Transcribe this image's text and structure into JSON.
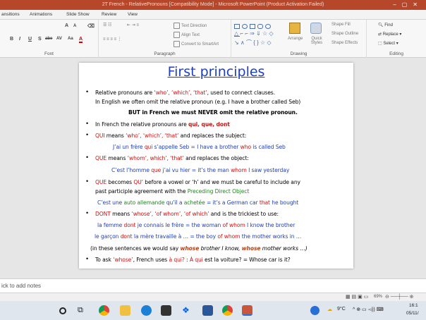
{
  "window": {
    "title": "2T French - RelativePronouns [Compatibility Mode] - Microsoft PowerPoint (Product Activation Failed)"
  },
  "tabs": [
    "ansitions",
    "Animations",
    "Slide Show",
    "Review",
    "View"
  ],
  "ribbon": {
    "groups": {
      "font": "Font",
      "paragraph": "Paragraph",
      "drawing": "Drawing",
      "editing": "Editing"
    },
    "paragraph_items": [
      "Text Direction",
      "Align Text",
      "Convert to SmartArt"
    ],
    "drawing_items": [
      "Arrange",
      "Quick Styles",
      "Shape Fill",
      "Shape Outline",
      "Shape Effects"
    ],
    "editing_items": [
      "Find",
      "Replace",
      "Select"
    ],
    "font_buttons": [
      "B",
      "I",
      "U",
      "S",
      "abe",
      "AV",
      "Aa",
      "A"
    ]
  },
  "slide": {
    "title": "First principles",
    "lines": {
      "l1a": "Relative pronouns are ",
      "l1b": "‘who’, ‘which’, ‘that’",
      "l1c": ", used to connect clauses.",
      "l2": "In English we often omit the relative pronoun (e.g. I have a brother called Seb)",
      "l3": "BUT in French we must NEVER omit the relative pronoun.",
      "l4a": "In French the relative pronouns are ",
      "l4b": "qui, que, dont",
      "l5a": "QUI",
      "l5b": " means ",
      "l5c": "‘who’, ‘which’, ‘that’",
      "l5d": " and replaces the subject:",
      "l6a": "J’ai un frère ",
      "l6b": "qui",
      "l6c": " s’appelle Seb",
      "l6d": " = I have a brother ",
      "l6e": "who",
      "l6f": " is called Seb",
      "l7a": "QUE",
      "l7b": " means ",
      "l7c": "‘whom’, which’, ‘that’",
      "l7d": " and replaces the object:",
      "l8a": "C’est l’homme ",
      "l8b": "que",
      "l8c": " j’ai vu hier",
      "l8d": " = it’s the man ",
      "l8e": "whom",
      "l8f": " I saw yesterday",
      "l9a": "QUE",
      "l9b": " becomes ",
      "l9c": "QU’",
      "l9d": " before a vowel or ‘h’ and we must be careful to include any",
      "l10a": "past participle agreement with the ",
      "l10b": "Preceding Direct Object",
      "l11a": "C’est une ",
      "l11b": "auto allemande",
      "l11c": " qu’il a ",
      "l11d": "achetée",
      "l11e": " = it’s a German car ",
      "l11f": "that",
      "l11g": " he bought",
      "l12a": "DONT",
      "l12b": " means ",
      "l12c": "‘whose’, ‘of whom’, ‘of which’",
      "l12d": " and is the trickiest to use:",
      "l13a": "la femme ",
      "l13b": "dont",
      "l13c": " je connais le frère = the woman ",
      "l13d": "of whom",
      "l13e": " I know the brother",
      "l14a": "le garçon ",
      "l14b": "dont",
      "l14c": " la mère travaille à … = the boy ",
      "l14d": "of whom",
      "l14e": " the mother works in …",
      "l15a": "(in these sentences we would say ",
      "l15b": "whose",
      "l15c": " brother I know, ",
      "l15d": "whose",
      "l15e": " mother works …)",
      "l16a": "To ask ",
      "l16b": "‘whose’",
      "l16c": ", French uses ",
      "l16d": "à qui?",
      "l16e": " : ",
      "l16f": "À qui",
      "l16g": " est la voiture? = Whose car is it?"
    }
  },
  "notes": {
    "placeholder": "ick to add notes"
  },
  "status": {
    "zoom": "69%"
  },
  "taskbar": {
    "weather": "9°C",
    "time": "16:1",
    "date": "05/11/"
  },
  "colors": {
    "title_bar": "#b7472a",
    "slide_title": "#1f3fbf",
    "red": "#d01010",
    "green": "#1a8a1a"
  }
}
